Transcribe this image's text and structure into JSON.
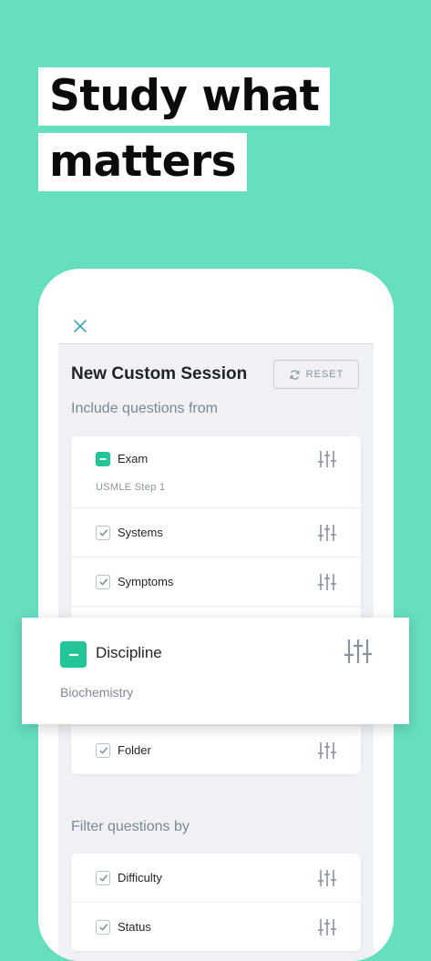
{
  "headline": {
    "line1": "Study what",
    "line2": "matters"
  },
  "session": {
    "title": "New Custom Session",
    "reset_label": "RESET",
    "include_label": "Include questions from",
    "filter_label": "Filter questions by"
  },
  "include_rows": [
    {
      "label": "Exam",
      "sub": "USMLE Step 1",
      "state": "indeterminate"
    },
    {
      "label": "Systems",
      "state": "checked"
    },
    {
      "label": "Symptoms",
      "state": "checked"
    },
    {
      "label": "Folder",
      "state": "checked"
    }
  ],
  "filter_rows": [
    {
      "label": "Difficulty",
      "state": "checked"
    },
    {
      "label": "Status",
      "state": "checked"
    }
  ],
  "popout": {
    "label": "Discipline",
    "sub": "Biochemistry",
    "state": "indeterminate"
  },
  "colors": {
    "background": "#66dfbf",
    "accent": "#23c497",
    "screen": "#eff1f5"
  },
  "icons": {
    "close": "close-icon",
    "reset": "refresh-icon",
    "filter": "sliders-icon",
    "check": "check-icon"
  }
}
